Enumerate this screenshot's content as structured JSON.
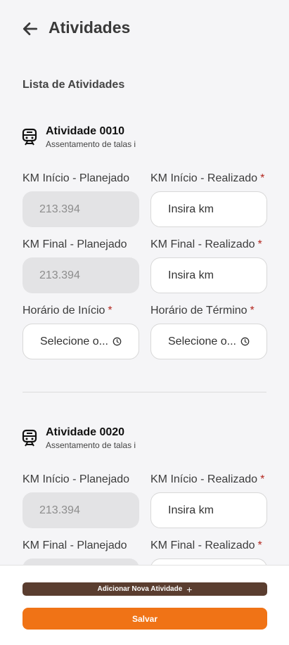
{
  "header": {
    "title": "Atividades"
  },
  "list_label": "Lista de Atividades",
  "activities": [
    {
      "title": "Atividade 0010",
      "subtitle": "Assentamento de talas i",
      "km_inicio_planejado_label": "KM Início - Planejado",
      "km_inicio_planejado_value": "213.394",
      "km_inicio_realizado_label": "KM Início - Realizado",
      "km_inicio_realizado_placeholder": "Insira km",
      "km_final_planejado_label": "KM Final - Planejado",
      "km_final_planejado_value": "213.394",
      "km_final_realizado_label": "KM Final - Realizado",
      "km_final_realizado_placeholder": "Insira km",
      "horario_inicio_label": "Horário de Início",
      "horario_inicio_placeholder": "Selecione o...",
      "horario_termino_label": "Horário de Término",
      "horario_termino_placeholder": "Selecione o..."
    },
    {
      "title": "Atividade 0020",
      "subtitle": "Assentamento de talas i",
      "km_inicio_planejado_label": "KM Início - Planejado",
      "km_inicio_planejado_value": "213.394",
      "km_inicio_realizado_label": "KM Início - Realizado",
      "km_inicio_realizado_placeholder": "Insira km",
      "km_final_planejado_label": "KM Final - Planejado",
      "km_final_realizado_label": "KM Final - Realizado"
    }
  ],
  "required_mark": "*",
  "footer": {
    "add_label": "Adicionar Nova Atividade",
    "add_icon": "+",
    "save_label": "Salvar"
  },
  "colors": {
    "primary": "#f07316",
    "secondary": "#5a3d2f",
    "required": "#b3261e",
    "disabled_field": "#e3e3e5"
  }
}
